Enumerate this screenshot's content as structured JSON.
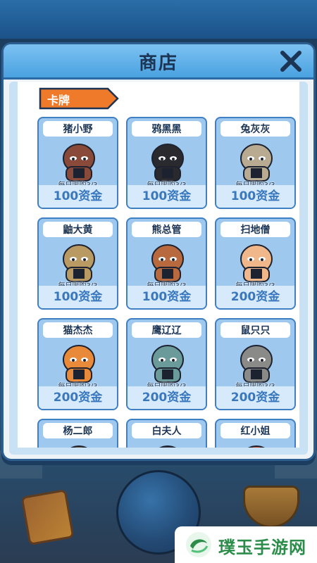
{
  "dialog": {
    "title": "商店",
    "close_icon": "close-x-icon"
  },
  "section": {
    "label": "卡牌"
  },
  "cards": [
    {
      "name": "猪小野",
      "limit": "每日限购3/3",
      "price": "100资金",
      "color": "#8a4a3a"
    },
    {
      "name": "鸦黑黑",
      "limit": "每日限购3/3",
      "price": "100资金",
      "color": "#2a2a2e"
    },
    {
      "name": "兔灰灰",
      "limit": "每日限购3/3",
      "price": "100资金",
      "color": "#b9ab92"
    },
    {
      "name": "鼬大黄",
      "limit": "每日限购3/3",
      "price": "100资金",
      "color": "#b99a62"
    },
    {
      "name": "熊总管",
      "limit": "每日限购3/3",
      "price": "100资金",
      "color": "#b86a3e"
    },
    {
      "name": "扫地僧",
      "limit": "每日限购3/3",
      "price": "200资金",
      "color": "#f0b88a"
    },
    {
      "name": "猫杰杰",
      "limit": "每日限购3/3",
      "price": "200资金",
      "color": "#e98a3a"
    },
    {
      "name": "鹰辽辽",
      "limit": "每日限购3/3",
      "price": "200资金",
      "color": "#6a9a9a"
    },
    {
      "name": "鼠只只",
      "limit": "每日限购3/3",
      "price": "200资金",
      "color": "#8a8a88"
    },
    {
      "name": "杨二郎",
      "limit": "",
      "price": "",
      "color": "#6a5a3a"
    },
    {
      "name": "白夫人",
      "limit": "",
      "price": "",
      "color": "#3a3a5a"
    },
    {
      "name": "红小姐",
      "limit": "",
      "price": "",
      "color": "#d04a2a"
    }
  ],
  "watermark": {
    "text": "璞玉手游网"
  }
}
